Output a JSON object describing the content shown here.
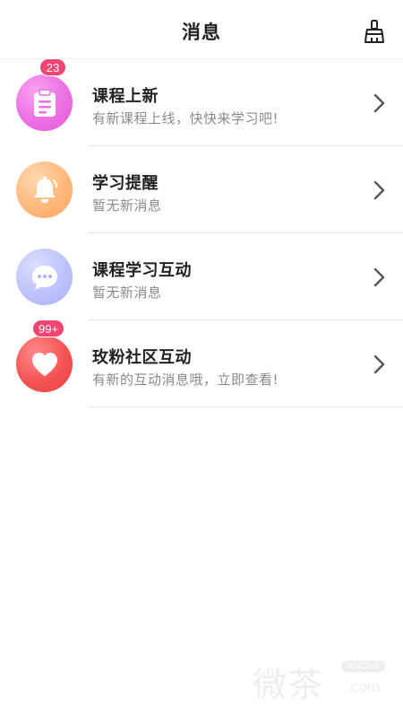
{
  "header": {
    "title": "消息",
    "clear_icon": "broom-icon"
  },
  "items": [
    {
      "title": "课程上新",
      "subtitle": "有新课程上线，快快来学习吧!",
      "badge": "23",
      "icon": "clipboard-icon",
      "color": "#ec6fe4"
    },
    {
      "title": "学习提醒",
      "subtitle": "暂无新消息",
      "badge": "",
      "icon": "bell-icon",
      "color": "#ffb87a"
    },
    {
      "title": "课程学习互动",
      "subtitle": "暂无新消息",
      "badge": "",
      "icon": "chat-bubble-icon",
      "color": "#bcc2fb"
    },
    {
      "title": "玫粉社区互动",
      "subtitle": "有新的互动消息哦，立即查看!",
      "badge": "99+",
      "icon": "heart-icon",
      "color": "#f45353"
    }
  ],
  "watermark": {
    "main": "微茶",
    "tag": "WXCHA",
    "suffix": ".com"
  },
  "colors": {
    "badge": "#f04574",
    "divider": "#e6e6e6"
  }
}
